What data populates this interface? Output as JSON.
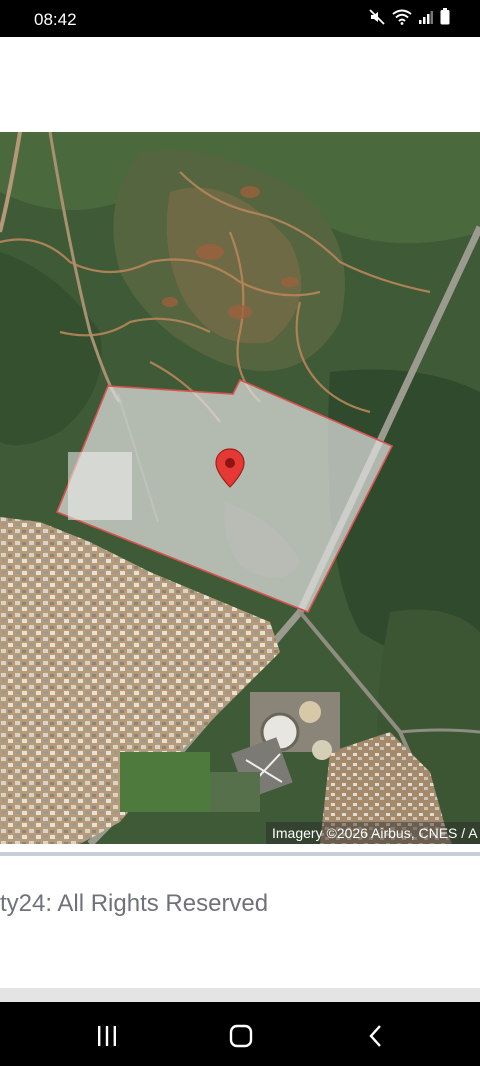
{
  "status_bar": {
    "time": "08:42",
    "icons": [
      "mute-icon",
      "wifi-icon",
      "signal-icon",
      "battery-icon"
    ]
  },
  "map": {
    "marker": "location-pin-icon",
    "marker_color": "#e53935",
    "polygon_outline_color": "#d9534f",
    "attribution": "Imagery ©2026 Airbus, CNES / A"
  },
  "footer": {
    "text": "ty24: All Rights Reserved"
  },
  "nav_bar": {
    "buttons": [
      "recent-apps-icon",
      "home-icon",
      "back-icon"
    ]
  }
}
